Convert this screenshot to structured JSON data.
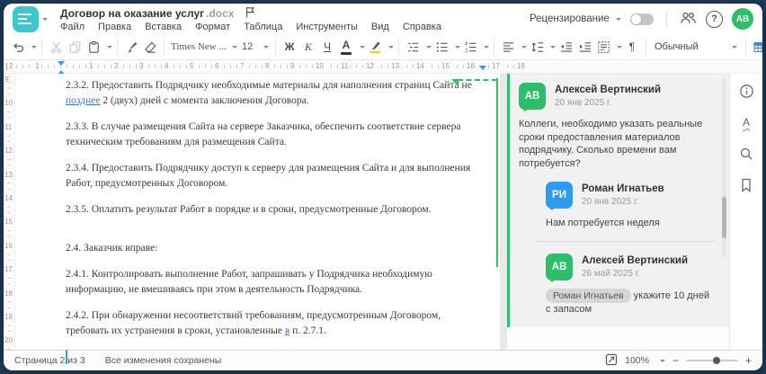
{
  "colors": {
    "outer_bg": "#1e3a57",
    "brand_teal": "#3fc6ce",
    "comment_green": "#2ebd68",
    "reply_blue": "#2d9bf0",
    "insert_blue": "#4a86c8",
    "track_change_blue": "#4a72c4",
    "highlight_yellow": "#f2cf1d"
  },
  "header": {
    "title": "Договор на оказание услуг",
    "ext": ".docx",
    "menu": [
      "Файл",
      "Правка",
      "Вставка",
      "Формат",
      "Таблица",
      "Инструменты",
      "Вид",
      "Справка"
    ],
    "review_label": "Рецензирование",
    "avatar_initials": "АВ",
    "help_glyph": "?"
  },
  "toolbar": {
    "font_name": "Times New ...",
    "font_size": "12",
    "bold_glyph": "Ж",
    "italic_glyph": "К",
    "underline_glyph": "Ч",
    "font_color_glyph": "А",
    "style_name": "Обычный",
    "paragraph_glyph": "¶",
    "more_glyph": "⋯"
  },
  "ruler": {
    "h_margin_numbers": [
      "2",
      "1"
    ],
    "h_numbers": [
      "1",
      "2",
      "3",
      "4",
      "5",
      "6",
      "7",
      "8",
      "9",
      "10",
      "11",
      "12",
      "13",
      "14",
      "15",
      "16",
      "17",
      "18"
    ],
    "v_numbers": [
      "9",
      "10",
      "11",
      "12",
      "13",
      "14",
      "15",
      "16",
      "17",
      "18",
      "19",
      "20"
    ]
  },
  "doc": {
    "p1a": "2.3.2. Предоставить Подрядчику необходимые материалы для наполнения страниц Сайта не ",
    "p1b": "позднее",
    "p1c": " 2 (двух) дней с момента заключения Договора.",
    "p2": "2.3.3. В случае размещения Сайта на сервере Заказчика, обеспечить соответствие сервера техническим требованиям для размещения Сайта.",
    "p3": "2.3.4. Предоставить Подрядчику доступ к серверу для размещения Сайта и для выполнения Работ, предусмотренных Договором.",
    "p4": "2.3.5. Оплатить результат Работ в порядке и в сроки, предусмотренные Договором.",
    "p5": "2.4. Заказчик вправе:",
    "p6": "2.4.1. Контролировать выполнение Работ, запрашивать у Подрядчика необходимую информацию, не вмешиваясь при этом в деятельность Подрядчика.",
    "p7a": "2.4.2. При обнаружении несоответствий требованиям, предусмотренным Договором, требовать их устранения в сроки, установленные ",
    "p7b": "в",
    "p7c": " п. 2.7.1."
  },
  "comments": {
    "root": {
      "initials": "АВ",
      "author": "Алексей Вертинский",
      "date": "20 янв 2025 г.",
      "text": "Коллеги, необходимо указать реальные сроки предоставления материалов подрядчику. Сколько времени вам потребуется?"
    },
    "reply1": {
      "initials": "РИ",
      "author": "Роман Игнатьев",
      "date": "20 янв 2025 г.",
      "text": "Нам потребуется неделя"
    },
    "reply2": {
      "initials": "АВ",
      "author": "Алексей Вертинский",
      "date": "26 май 2025 г.",
      "mention": "Роман Игнатьев",
      "text": " укажите 10 дней с запасом"
    }
  },
  "sidebar_icons": {
    "spellcheck_glyph": "А"
  },
  "statusbar": {
    "page": "Страница 2 из 3",
    "saved": "Все изменения сохранены",
    "zoom": "100%",
    "minus": "−",
    "plus": "+"
  }
}
